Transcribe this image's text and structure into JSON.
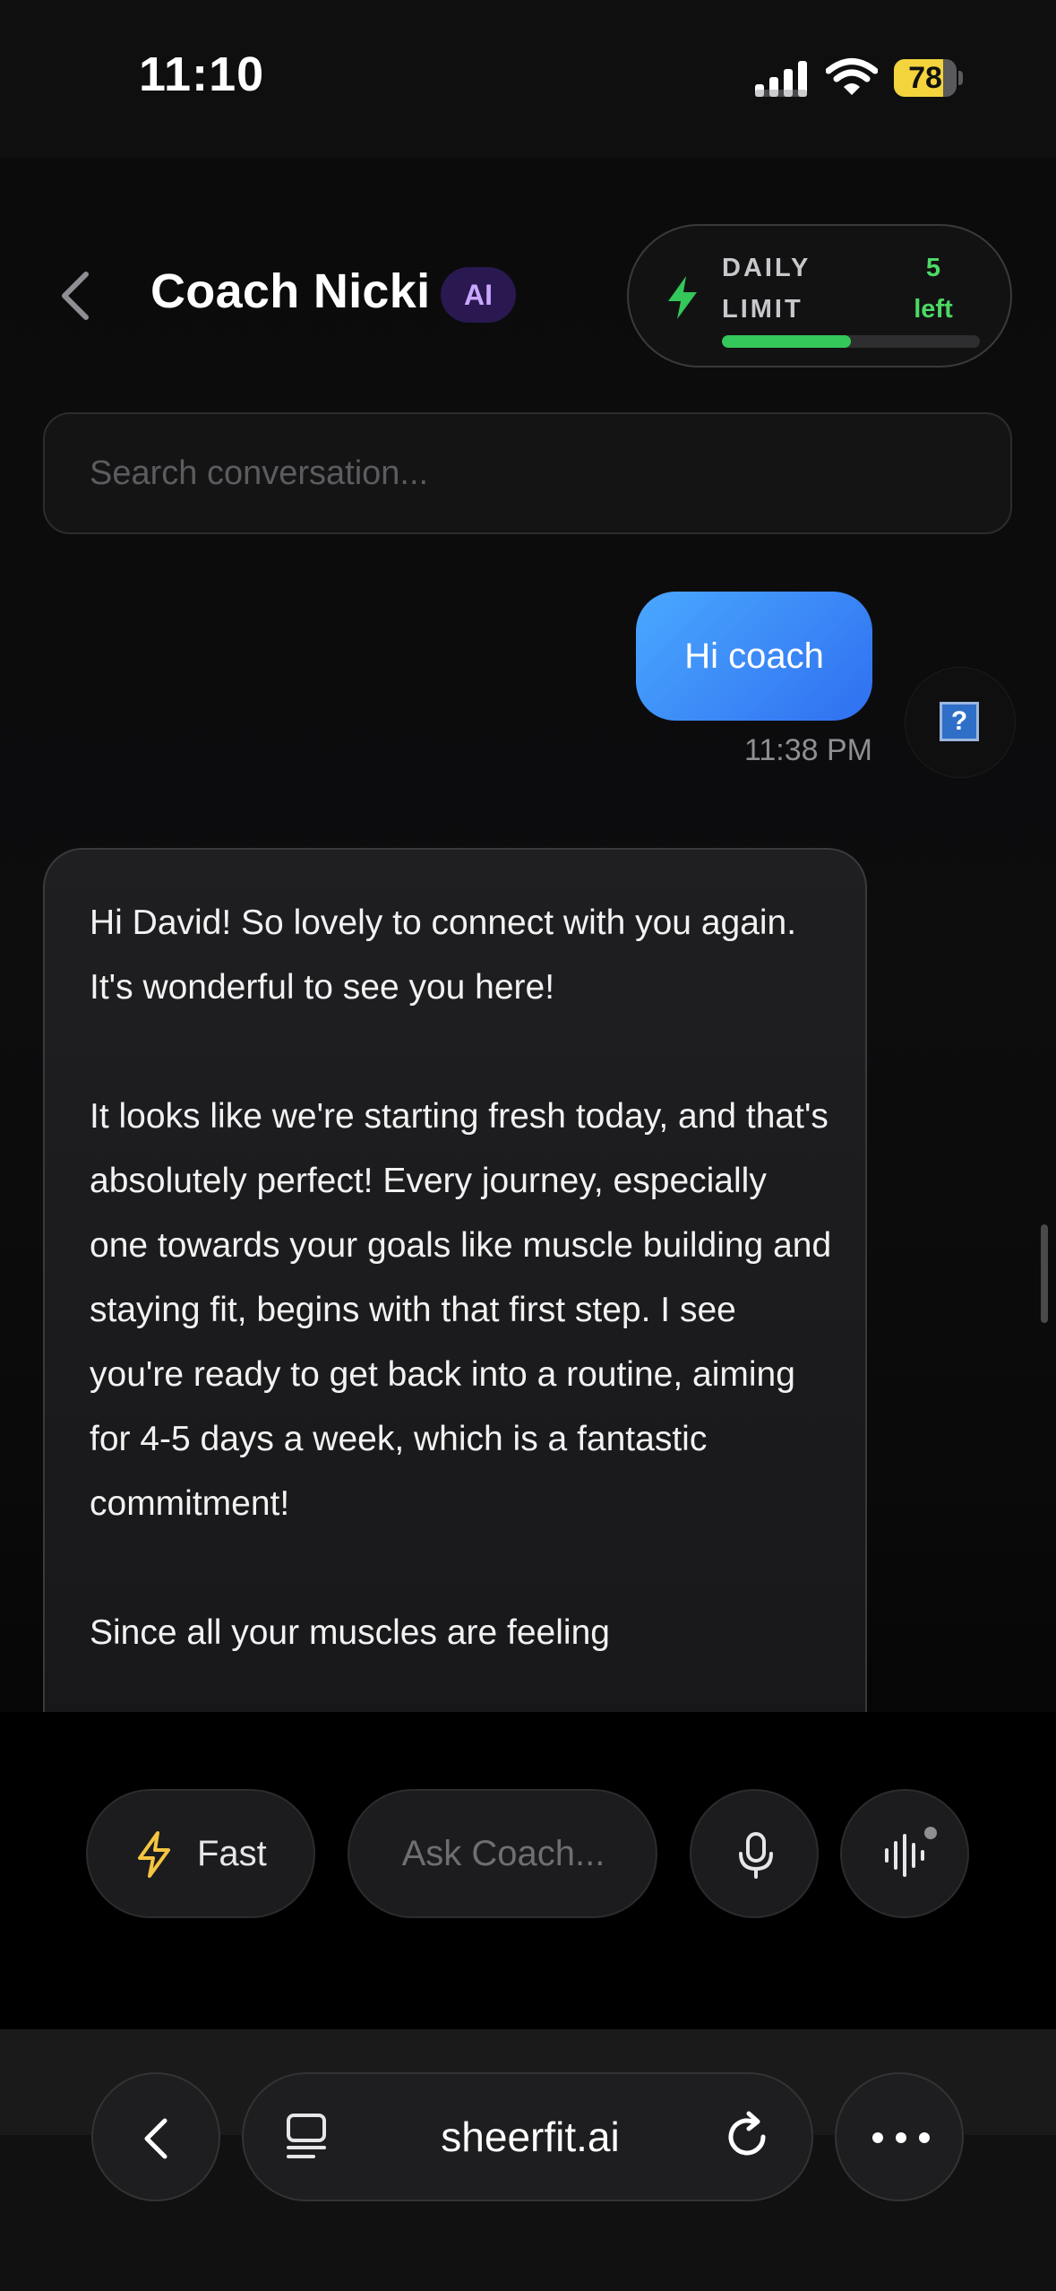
{
  "status_bar": {
    "time": "11:10",
    "battery_percent": "78",
    "battery_level": 0.78,
    "icons": [
      "signal-icon",
      "wifi-icon",
      "battery-icon"
    ]
  },
  "header": {
    "back_icon": "chevron-left-icon",
    "title": "Coach Nicki",
    "badge": "AI",
    "daily_limit": {
      "label": "DAILY LIMIT",
      "count": "5 left",
      "progress": 0.5,
      "icon": "lightning-bolt-icon"
    }
  },
  "search": {
    "placeholder": "Search conversation..."
  },
  "messages": [
    {
      "sender": "user",
      "text": "Hi coach",
      "time": "11:38 PM",
      "avatar_icon": "broken-image-icon",
      "avatar_text": "?"
    },
    {
      "sender": "coach",
      "paragraphs": [
        "Hi David! So lovely to connect with you again. It's wonderful to see you here!",
        "It looks like we're starting fresh today, and that's absolutely perfect! Every journey, especially one towards your goals like muscle building and staying fit, begins with that first step. I see you're ready to get back into a routine, aiming for 4-5 days a week, which is a fantastic commitment!",
        "Since all your muscles are feeling"
      ]
    }
  ],
  "composer": {
    "mode_label": "Fast",
    "mode_icon": "lightning-bolt-icon",
    "input_placeholder": "Ask Coach...",
    "mic_icon": "microphone-icon",
    "voice_icon": "waveform-icon"
  },
  "browser": {
    "url": "sheerfit.ai",
    "icons": [
      "chevron-left-icon",
      "tabs-icon",
      "reload-icon",
      "more-icon"
    ]
  },
  "colors": {
    "accent_blue": "#2f6ff0",
    "limit_green": "#34c759",
    "bolt_yellow": "#f5c542",
    "ai_badge_purple": "#c9a7ff"
  }
}
